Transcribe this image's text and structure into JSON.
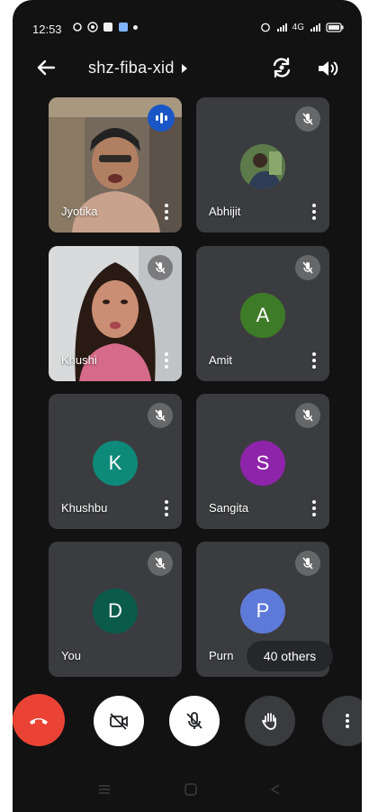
{
  "status_bar": {
    "time": "12:53",
    "right_indicators": "4G"
  },
  "header": {
    "meeting_code": "shz-fiba-xid"
  },
  "participants": [
    {
      "name": "Jyotika",
      "state": "video",
      "speaking": true
    },
    {
      "name": "Abhijit",
      "state": "photo-avatar",
      "muted": true
    },
    {
      "name": "Khushi",
      "state": "video",
      "muted": true
    },
    {
      "name": "Amit",
      "initial": "A",
      "avatar_color": "#3e7b27",
      "muted": true
    },
    {
      "name": "Khushbu",
      "initial": "K",
      "avatar_color": "#0e8a7a",
      "muted": true
    },
    {
      "name": "Sangita",
      "initial": "S",
      "avatar_color": "#8e24aa",
      "muted": true
    },
    {
      "name": "You",
      "initial": "D",
      "avatar_color": "#0b5b4b",
      "muted": true
    },
    {
      "name": "Purn",
      "initial": "P",
      "avatar_color": "#5e7ad8",
      "muted": true
    }
  ],
  "others_pill": "40 others",
  "controls": {
    "end_call_icon": "phone-hangup-icon",
    "camera_icon": "camera-off-icon",
    "mic_icon": "mic-off-icon",
    "hand_icon": "raise-hand-icon",
    "more_icon": "more-vertical-icon"
  },
  "colors": {
    "end_call": "#ea4335",
    "speaking": "#1a56c6",
    "background": "#121212",
    "tile": "#3b3c3f"
  }
}
